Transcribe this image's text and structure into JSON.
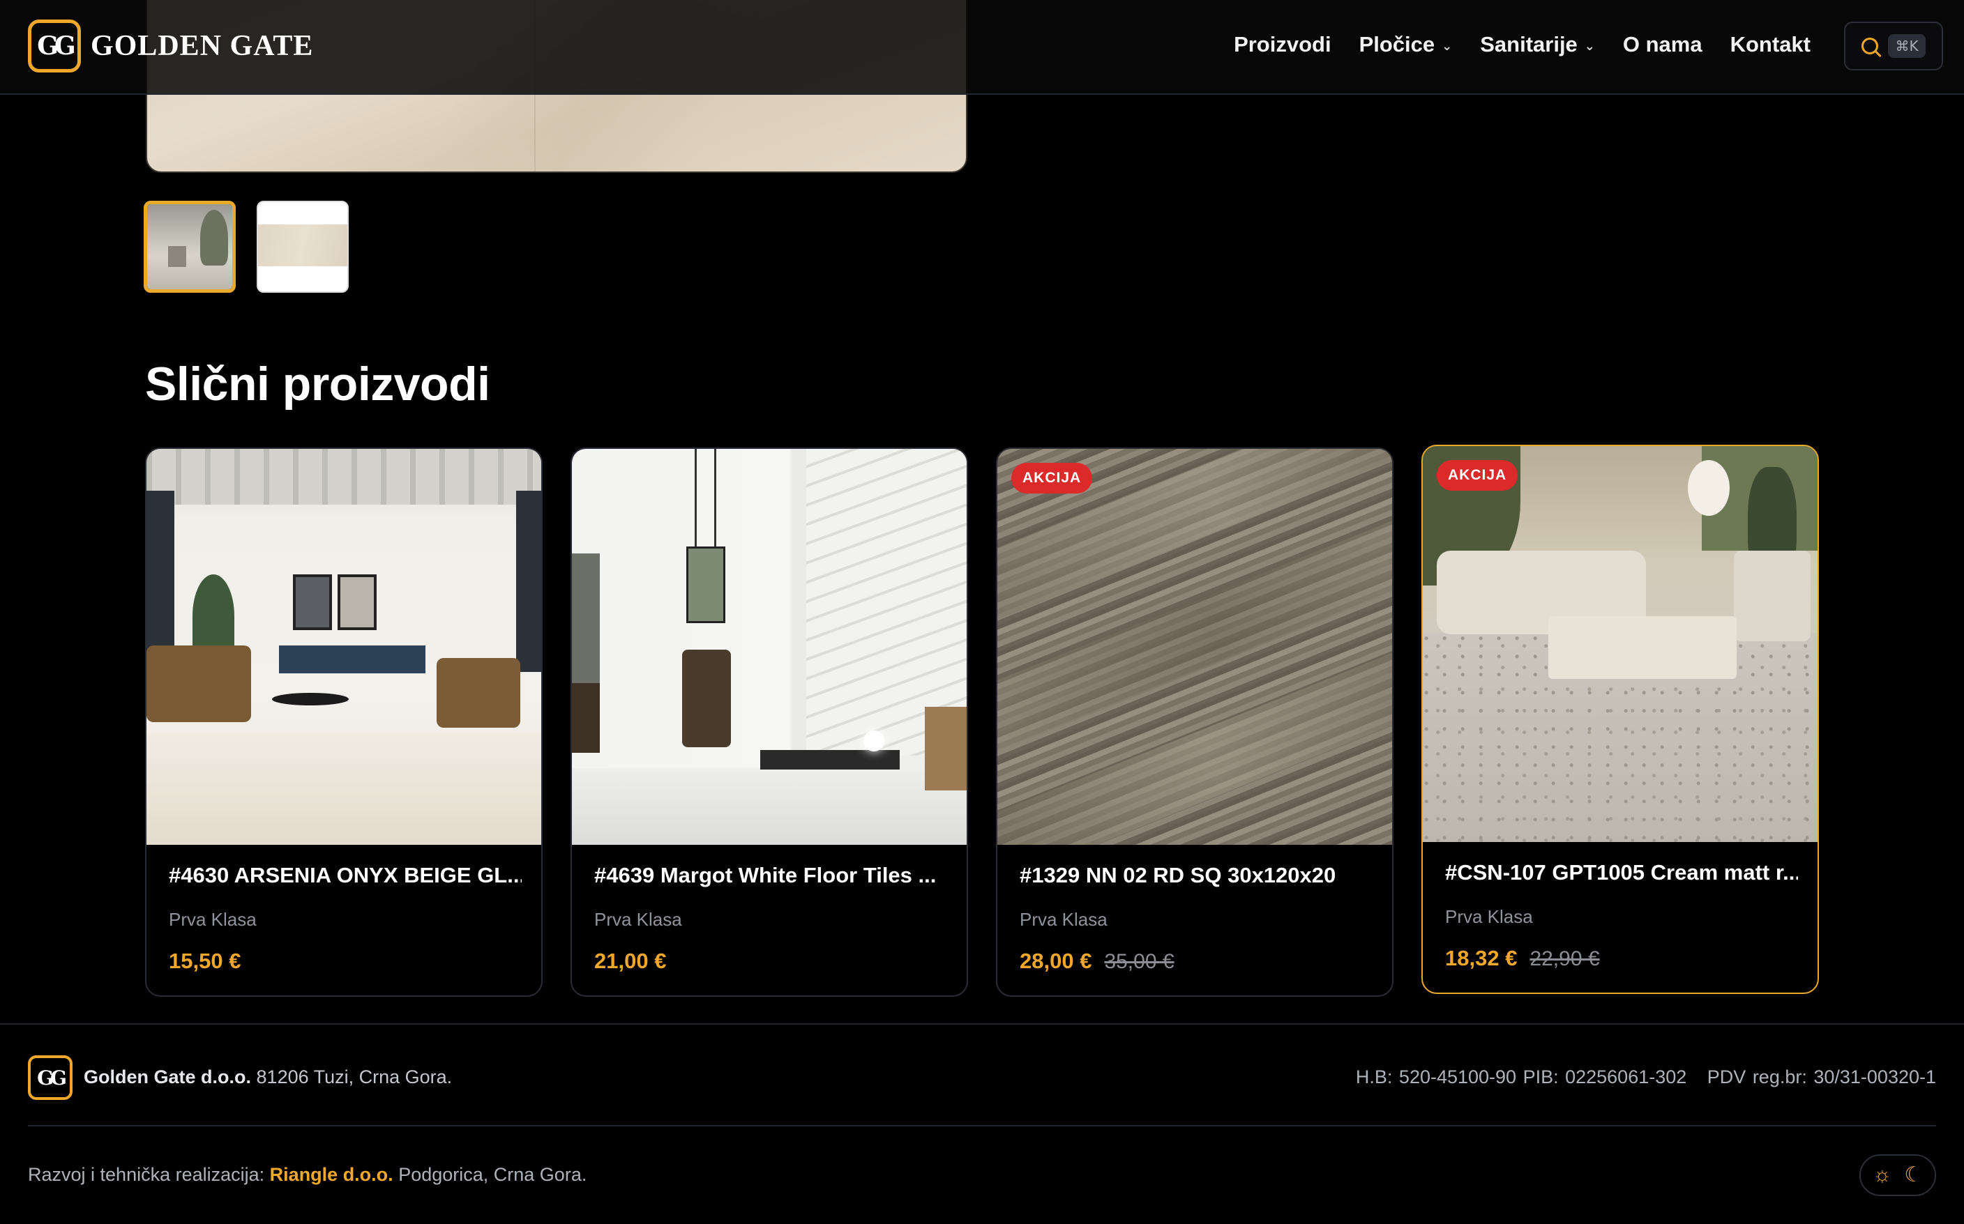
{
  "header": {
    "brand": "GOLDEN GATE",
    "logo_glyph": "GG",
    "nav": [
      {
        "label": "Proizvodi",
        "has_dropdown": false
      },
      {
        "label": "Pločice",
        "has_dropdown": true
      },
      {
        "label": "Sanitarije",
        "has_dropdown": true
      },
      {
        "label": "O nama",
        "has_dropdown": false
      },
      {
        "label": "Kontakt",
        "has_dropdown": false
      }
    ],
    "search_shortcut": "⌘K",
    "search_icon": "search-icon"
  },
  "gallery": {
    "selected_thumbnail": 1,
    "thumbnail_count": 2
  },
  "similar": {
    "title": "Slični proizvodi",
    "products": [
      {
        "name": "#4630 ARSENIA ONYX BEIGE GL...",
        "class": "Prva Klasa",
        "price": "15,50 €",
        "old_price": "",
        "badge": ""
      },
      {
        "name": "#4639 Margot White Floor Tiles ...",
        "class": "Prva Klasa",
        "price": "21,00 €",
        "old_price": "",
        "badge": ""
      },
      {
        "name": "#1329 NN 02 RD SQ 30x120x20",
        "class": "Prva Klasa",
        "price": "28,00 €",
        "old_price": "35,00 €",
        "badge": "AKCIJA"
      },
      {
        "name": "#CSN-107 GPT1005 Cream matt r...",
        "class": "Prva Klasa",
        "price": "18,32 €",
        "old_price": "22,90 €",
        "badge": "AKCIJA"
      }
    ]
  },
  "footer": {
    "company_name": "Golden Gate d.o.o.",
    "company_address": "81206 Tuzi, Crna Gora.",
    "legal_hb_pib": "H.B: 520-45100-90 PIB: 02256061-302",
    "legal_pdv": "PDV reg.br: 30/31-00320-1",
    "credit_prefix": "Razvoj i tehnička realizacija:",
    "credit_link": "Riangle d.o.o.",
    "credit_suffix": "Podgorica, Crna Gora."
  },
  "colors": {
    "accent": "#f0a72a",
    "badge": "#dc2a2a",
    "background": "#000000"
  }
}
